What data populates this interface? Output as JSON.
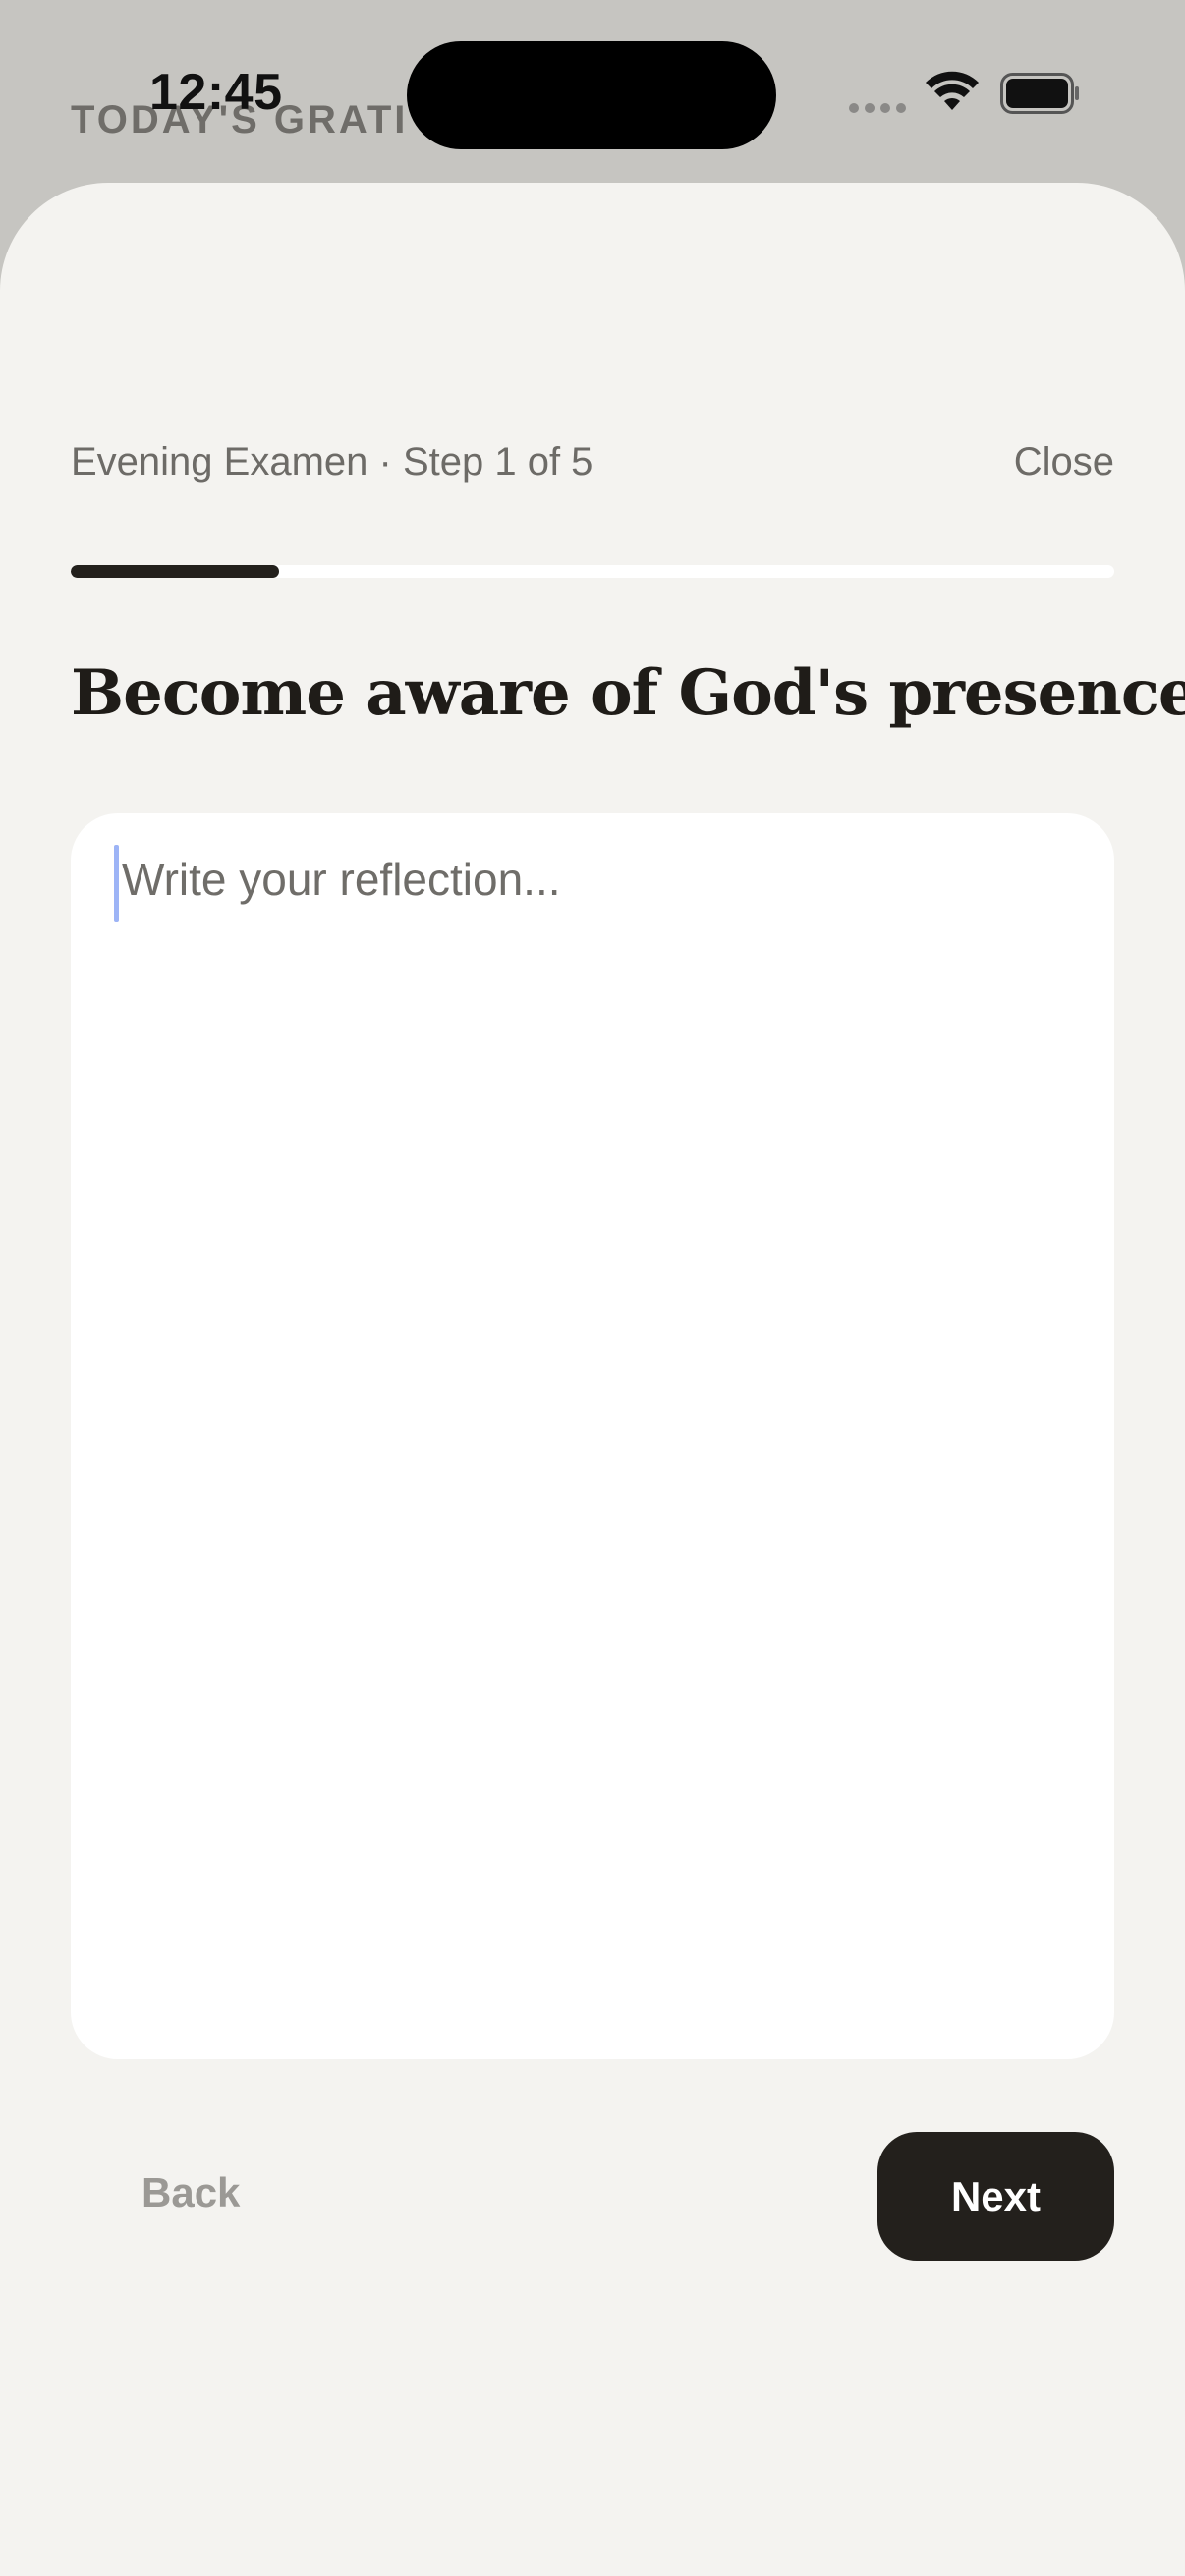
{
  "status_bar": {
    "time": "12:45"
  },
  "background_screen": {
    "heading": "TODAY'S GRATI"
  },
  "examen": {
    "step_label": "Evening Examen · Step 1 of 5",
    "close_label": "Close",
    "progress": {
      "current_step": 1,
      "total_steps": 5
    },
    "prompt": "Become aware of God's presence.",
    "reflection": {
      "value": "",
      "placeholder": "Write your reflection..."
    },
    "back_label": "Back",
    "next_label": "Next"
  },
  "colors": {
    "accent": "#23201c",
    "sheet_background": "#f4f3f0",
    "caret": "#9db4f6"
  },
  "icons": [
    "wifi-icon",
    "battery-icon",
    "cellular-signal-icon"
  ]
}
